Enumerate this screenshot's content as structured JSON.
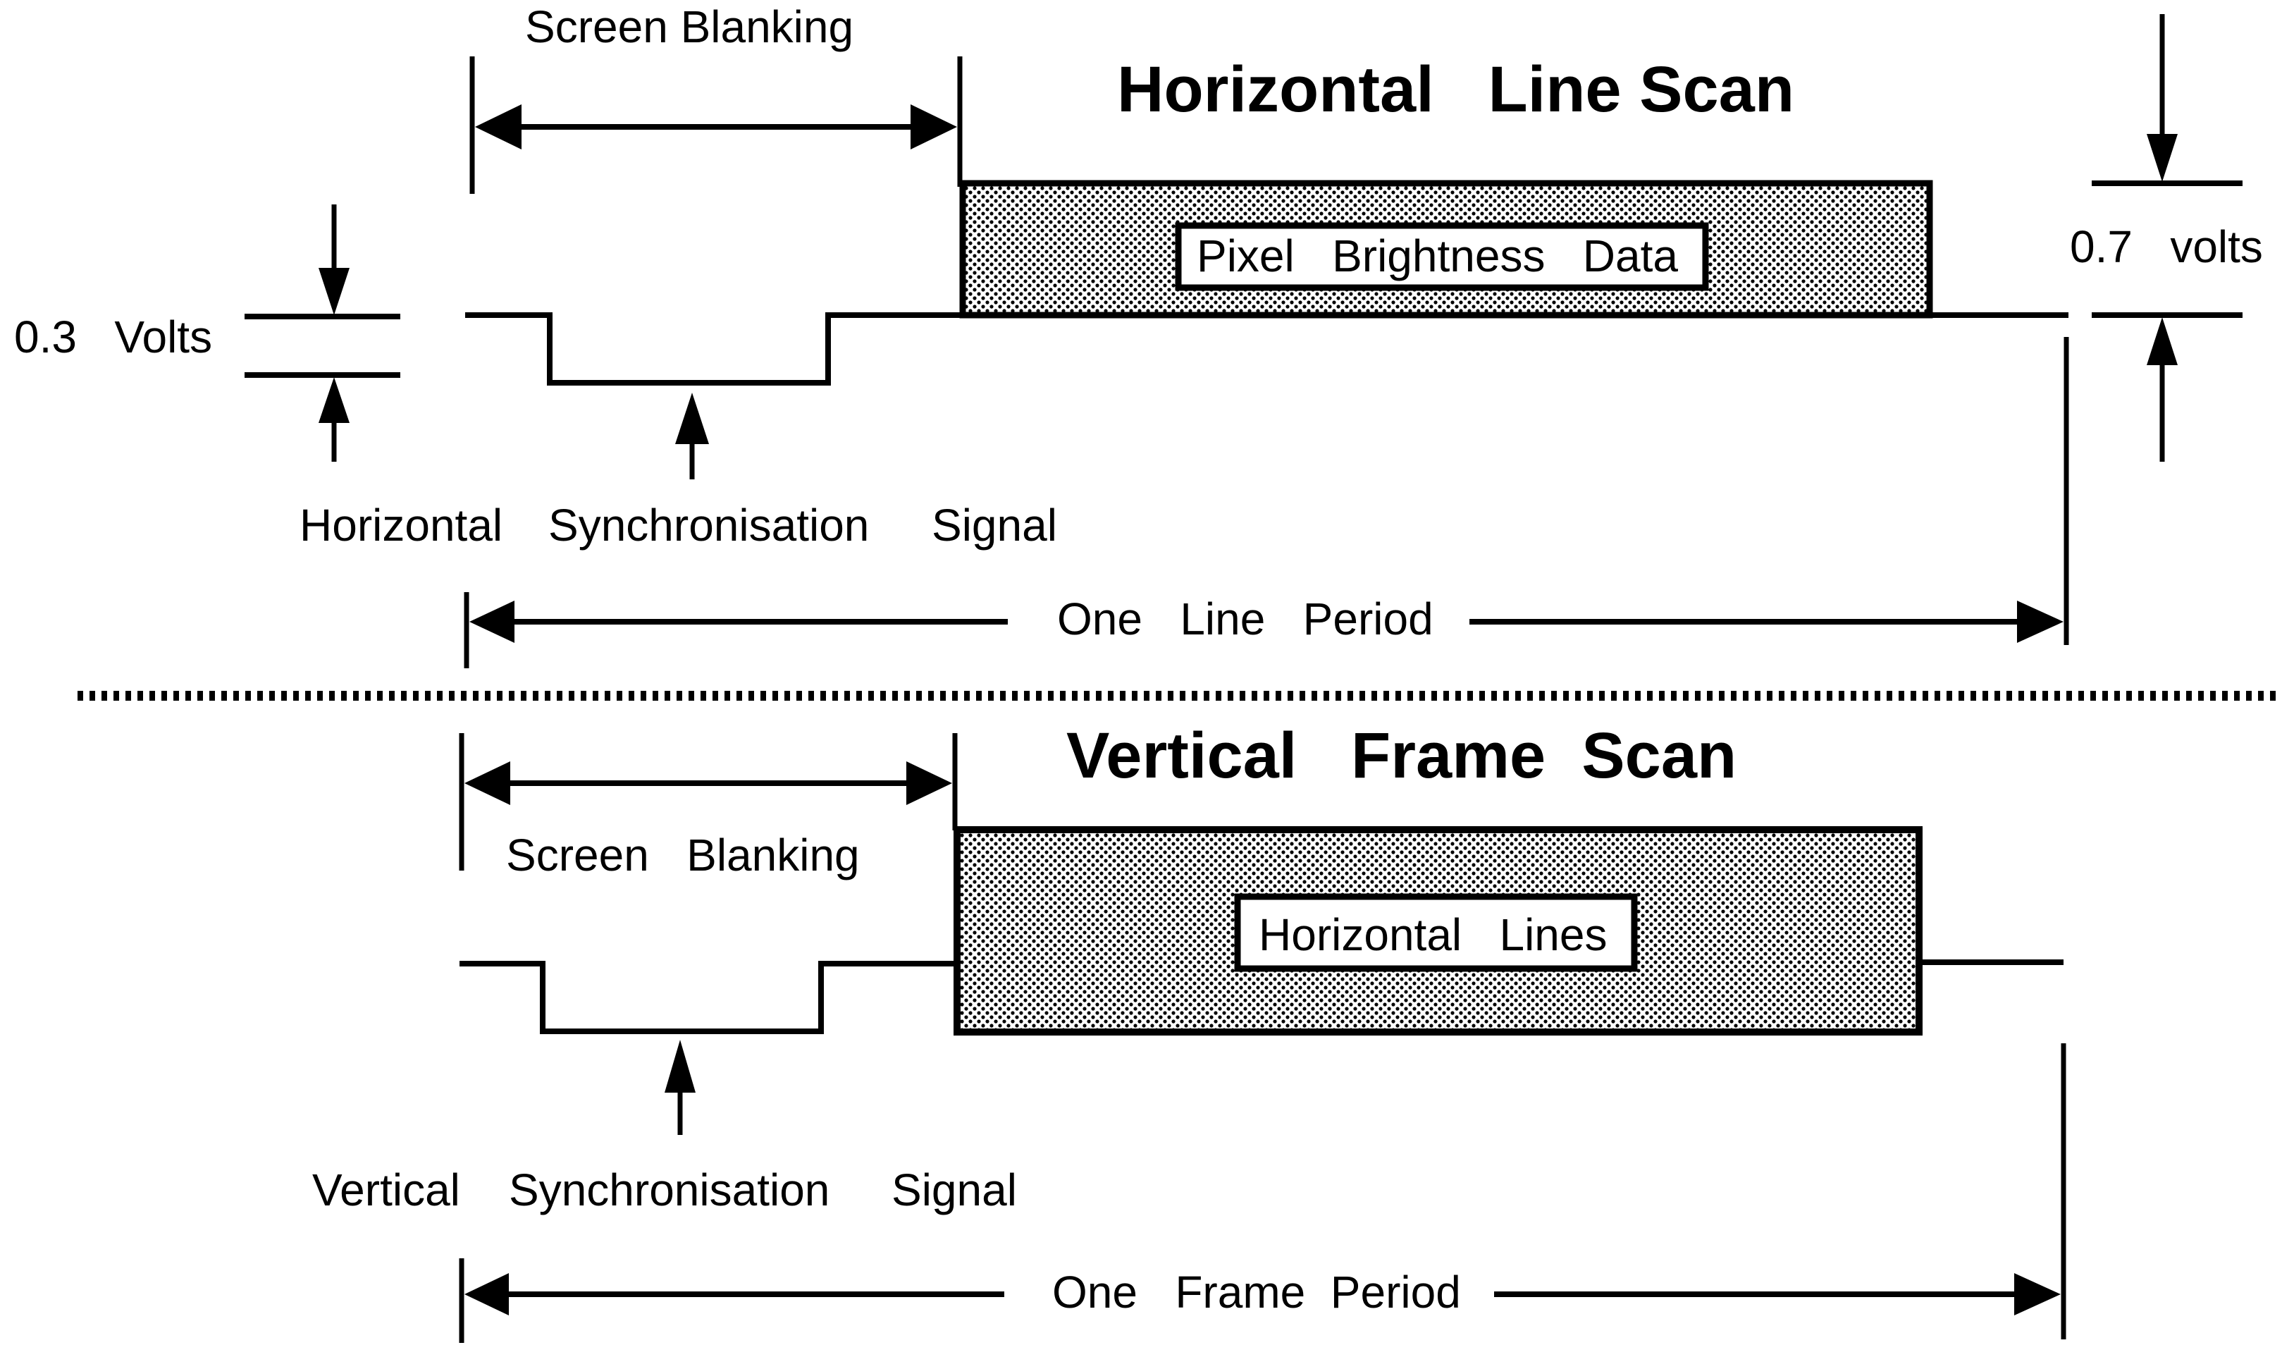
{
  "horizontal_section": {
    "title": "Horizontal   Line Scan",
    "screen_blanking_label": "Screen   Blanking",
    "data_box_label": "Pixel   Brightness   Data",
    "sync_label_1": "Horizontal",
    "sync_label_2": "Synchronisation",
    "sync_label_3": "Signal",
    "period_label": "One   Line   Period",
    "sync_amplitude_label": "0.3   Volts",
    "data_amplitude_label": "0.7   volts"
  },
  "vertical_section": {
    "title": "Vertical   Frame  Scan",
    "screen_blanking_label": "Screen   Blanking",
    "data_box_label": "Horizontal   Lines",
    "sync_label_1": "Vertical",
    "sync_label_2": "Synchronisation",
    "sync_label_3": "Signal",
    "period_label": "One   Frame  Period"
  },
  "colors": {
    "ink": "#000000",
    "background": "#ffffff",
    "hatch_fill": "#9a9a9a"
  }
}
